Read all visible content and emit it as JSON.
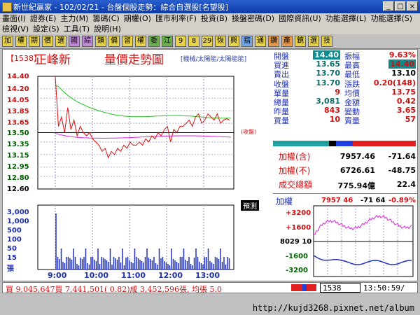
{
  "window": {
    "title": "新世紀贏家 - 102/02/21 - 台盤個股走勢：綜合自選股[名望股]",
    "buttons": [
      "_",
      "□",
      "×"
    ]
  },
  "menu": {
    "row1": [
      "畫面(I)",
      "證券(E)",
      "主力(M)",
      "籌碼(C)",
      "期權(O)",
      "匯市利率(F)",
      "投資(B)",
      "操盤密碼(D)",
      "國際資訊(U)",
      "功能選擇(L)",
      "功能選擇(S)"
    ],
    "row2": [
      "檢視(V)",
      "設定(S)",
      "工具(T)",
      "說明(H)"
    ]
  },
  "toolbar": [
    "加",
    "權",
    "期",
    "價",
    "選",
    "國",
    "綜",
    "類",
    "偏",
    "習",
    "權",
    "委",
    "江",
    "9",
    "8",
    "29",
    "恢",
    "興",
    "指",
    "通",
    "鑽",
    "產",
    "鏡",
    "選",
    "技"
  ],
  "chart": {
    "code": "【1538】",
    "name": "正峰新",
    "title": "量價走勢圖",
    "tags": "[機械/太陽能/太陽能能]",
    "mark": "預測",
    "close_mark": "(收盤)",
    "y_labels": [
      "14.40",
      "14.20",
      "14.05",
      "13.85",
      "13.65",
      "13.50",
      "13.35",
      "13.15",
      "12.95",
      "12.80",
      "12.60"
    ],
    "vol_labels": [
      "3,000",
      "1,000",
      "500",
      "100",
      "50",
      "15",
      "張"
    ],
    "x_labels": [
      "9:00",
      "10:00",
      "11:00",
      "12:00",
      "13:00"
    ]
  },
  "quote": [
    {
      "l1": "開盤",
      "v1": "14.40",
      "l2": "振幅",
      "v2": "9.63%"
    },
    {
      "l1": "買進",
      "v1": "13.65",
      "l2": "最高",
      "v2": "14.40"
    },
    {
      "l1": "賣出",
      "v1": "13.70",
      "l2": "最低",
      "v2": "13.10"
    },
    {
      "l1": "收盤",
      "v1": "13.70",
      "l2": "漲跌",
      "v2": "0.20(148)"
    },
    {
      "l1": "單量",
      "v1": "9",
      "l2": "均價",
      "v2": "13.75"
    },
    {
      "l1": "總量",
      "v1": "3,081",
      "l2": "金額",
      "v2": "0.42"
    },
    {
      "l1": "昨量",
      "v1": "843",
      "l2": "變動",
      "v2": "3.65"
    },
    {
      "l1": "買量",
      "v1": "10",
      "l2": "賣量",
      "v2": "57"
    }
  ],
  "index": [
    {
      "label": "加權(含)",
      "value": "7957.46",
      "change": "-71.64"
    },
    {
      "label": "加權(不)",
      "value": "6726.61",
      "change": "-48.75"
    },
    {
      "label": "成交總額",
      "value": "775.94億",
      "change": "22.4"
    }
  ],
  "mini": {
    "title": "加權",
    "value": "7957 46",
    "change": "-71 64",
    "pct": "-0.89%",
    "y_labels": [
      "+3200",
      "+1600",
      "8029 10",
      "-1600",
      "-3200"
    ]
  },
  "status": {
    "text": "買 9,045,647買 7,441,501( 0.82)成 3,452,596張, 均張 5.0",
    "code": "1538",
    "time": "13:50:59/"
  },
  "watermark": "http://kujd3268.pixnet.net/album",
  "chart_data": {
    "type": "line",
    "x_labels": [
      "9:00",
      "10:00",
      "11:00",
      "12:00",
      "13:00"
    ],
    "y_labels": [
      "14.40",
      "14.20",
      "14.05",
      "13.85",
      "13.65",
      "13.50",
      "13.35",
      "13.15",
      "12.95",
      "12.80",
      "12.60"
    ],
    "ylim": [
      12.6,
      14.4
    ],
    "reference_close": 13.5,
    "open": 14.4,
    "high": 14.4,
    "low": 13.1,
    "last": 13.7,
    "average": 13.75
  }
}
